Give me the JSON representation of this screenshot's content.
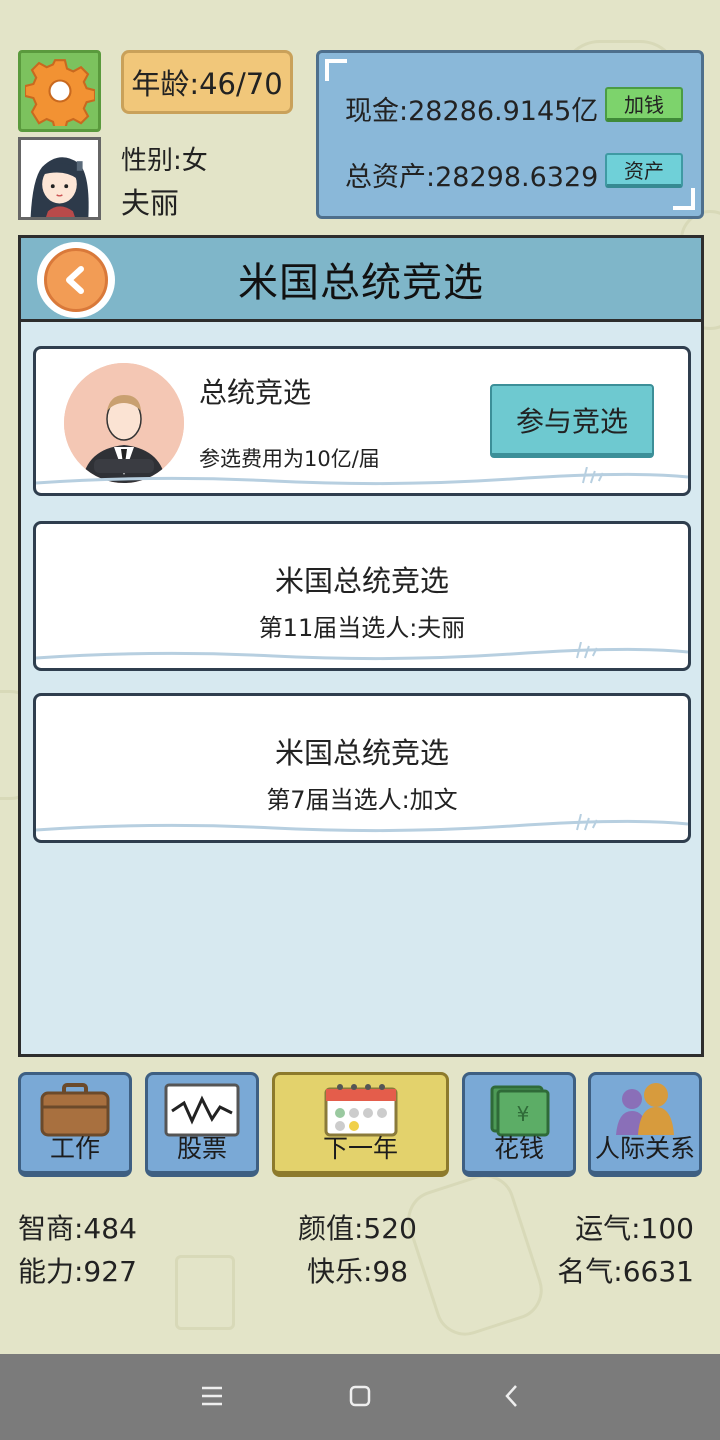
{
  "player": {
    "age_label": "年龄:46/70",
    "gender_label": "性别:女",
    "name": "夫丽"
  },
  "money": {
    "cash_label": "现金:",
    "cash_value": "28286.9145亿",
    "add_money_button": "加钱",
    "assets_label": "总资产:",
    "assets_value": "28298.6329",
    "assets_button": "资产"
  },
  "panel": {
    "title": "米国总统竞选",
    "election_card": {
      "title": "总统竞选",
      "fee": "参选费用为10亿/届",
      "join_button": "参与竞选"
    },
    "results": [
      {
        "title": "米国总统竞选",
        "winner": "第11届当选人:夫丽"
      },
      {
        "title": "米国总统竞选",
        "winner": "第7届当选人:加文"
      }
    ]
  },
  "nav": [
    {
      "label": "工作",
      "icon": "briefcase-icon"
    },
    {
      "label": "股票",
      "icon": "stock-chart-icon"
    },
    {
      "label": "下一年",
      "icon": "calendar-icon"
    },
    {
      "label": "花钱",
      "icon": "money-stack-icon"
    },
    {
      "label": "人际关系",
      "icon": "people-icon"
    }
  ],
  "stats": {
    "iq": "智商:484",
    "looks": "颜值:520",
    "luck": "运气:100",
    "ability": "能力:927",
    "happiness": "快乐:98",
    "fame": "名气:6631"
  },
  "colors": {
    "background": "#e3e4c8",
    "panel_bg": "#d7e9f0",
    "header_bg": "#7fb6c9",
    "nav_blue": "#7aa9d6",
    "nav_yellow": "#e3d26c",
    "settings_green": "#7cc25e",
    "age_orange": "#f1c77a"
  }
}
